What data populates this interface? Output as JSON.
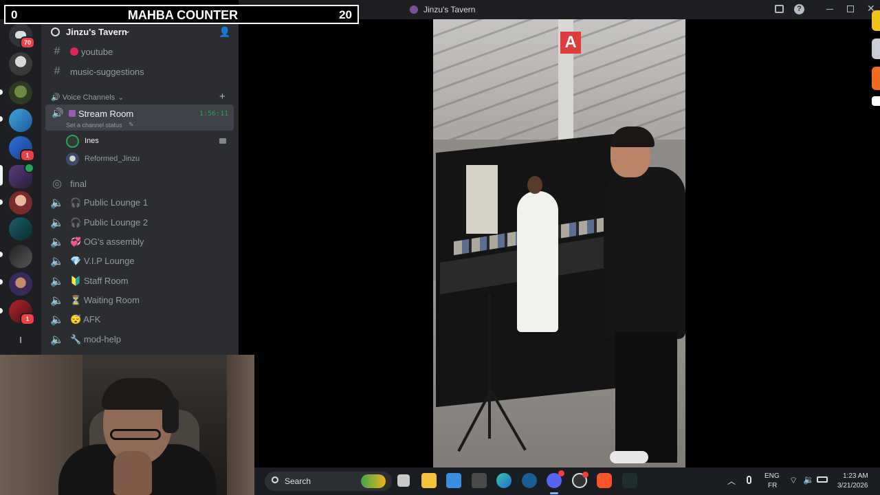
{
  "counter": {
    "left_value": "0",
    "title": "MAHBA COUNTER",
    "right_value": "20"
  },
  "window": {
    "title": "Jinzu's Tavern"
  },
  "rail": {
    "dm_badge": "70",
    "badges": [
      "1",
      "1"
    ],
    "letter_server": "I"
  },
  "server": {
    "name": "Jinzu's Tavern"
  },
  "channels": {
    "text": [
      {
        "label": "youtube",
        "emoji_color": "#e0245e"
      },
      {
        "label": "music-suggestions"
      }
    ],
    "voice_category": "Voice Channels",
    "stream_room": {
      "label": "Stream Room",
      "timer": "1:56:11",
      "status": "Set a channel status"
    },
    "users": [
      "Ines",
      "Reformed_Jinzu"
    ],
    "stage": "final",
    "voice": [
      {
        "label": "Public Lounge 1",
        "emoji": "🎧"
      },
      {
        "label": "Public Lounge 2",
        "emoji": "🎧"
      },
      {
        "label": "OG's assembly",
        "emoji": "💞"
      },
      {
        "label": "V.I.P Lounge",
        "emoji": "💎"
      },
      {
        "label": "Staff Room",
        "emoji": "🔰"
      },
      {
        "label": "Waiting Room",
        "emoji": "⏳"
      },
      {
        "label": "AFK",
        "emoji": "😴"
      },
      {
        "label": "mod-help",
        "emoji": "🔧"
      }
    ]
  },
  "taskbar": {
    "search": "Search",
    "lang": "ENG",
    "lang2": "FR",
    "time": "1:23 AM",
    "date": "3/21/2026"
  },
  "colors": {
    "accent": "#5865f2",
    "voice_active": "#23a55a",
    "badge": "#f23f43"
  },
  "video": {
    "booth_sign": "A"
  }
}
